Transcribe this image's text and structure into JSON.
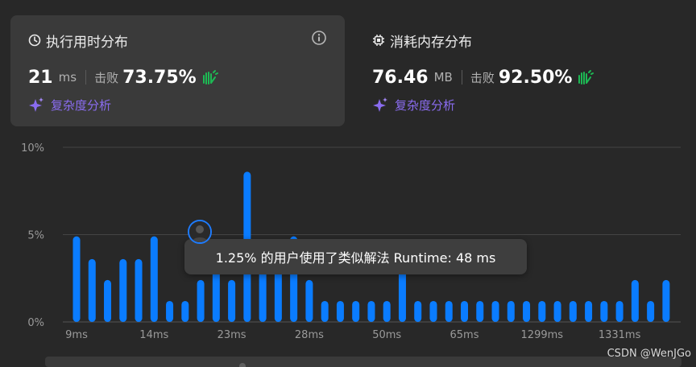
{
  "runtime_card": {
    "title": "执行用时分布",
    "value": "21",
    "unit": "ms",
    "beat_label": "击败",
    "beat_pct": "73.75%",
    "analysis_label": "复杂度分析"
  },
  "memory_card": {
    "title": "消耗内存分布",
    "value": "76.46",
    "unit": "MB",
    "beat_label": "击败",
    "beat_pct": "92.50%",
    "analysis_label": "复杂度分析"
  },
  "tooltip": {
    "text": "1.25% 的用户使用了类似解法 Runtime: 48 ms"
  },
  "watermark": "CSDN @WenJGo",
  "colors": {
    "bar": "#0a7cff",
    "clap": "#1db954",
    "analysis": "#8a6cf0",
    "avatar_border": "#1e7cff"
  },
  "chart_data": {
    "type": "bar",
    "y_tick_labels": [
      "10%",
      "5%",
      "0%"
    ],
    "ylim": [
      0,
      10
    ],
    "x_tick_labels": [
      "9ms",
      "14ms",
      "23ms",
      "28ms",
      "50ms",
      "65ms",
      "1299ms",
      "1331ms"
    ],
    "values": [
      4.9,
      3.6,
      2.4,
      3.6,
      3.6,
      4.9,
      1.2,
      1.2,
      2.4,
      3.6,
      2.4,
      8.6,
      3.6,
      3.6,
      4.9,
      2.4,
      1.2,
      1.2,
      1.2,
      1.2,
      1.2,
      3.6,
      1.2,
      1.2,
      1.2,
      1.2,
      1.2,
      1.2,
      1.2,
      1.2,
      1.2,
      1.2,
      1.2,
      1.2,
      1.2,
      1.2,
      2.4,
      1.2,
      2.4
    ]
  }
}
